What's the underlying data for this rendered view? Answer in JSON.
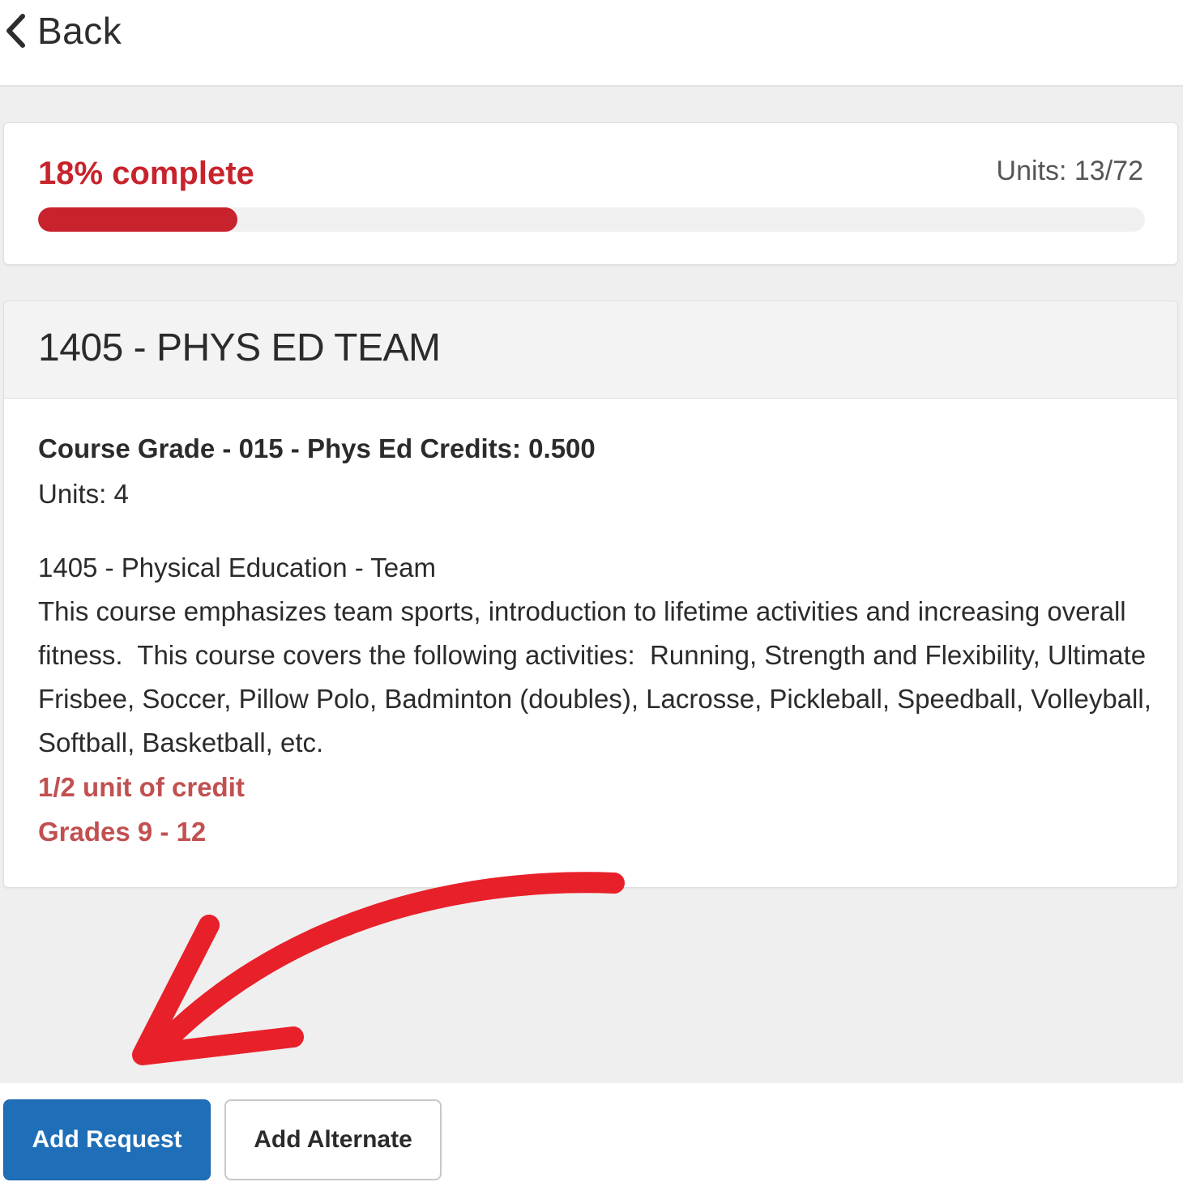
{
  "nav": {
    "back_label": "Back"
  },
  "progress": {
    "label": "18% complete",
    "percent": 18,
    "units_label": "Units: 13/72"
  },
  "course": {
    "title": "1405 - PHYS ED TEAM",
    "grade_line": "Course Grade - 015 - Phys Ed Credits: 0.500",
    "units_line": "Units: 4",
    "description_title": "1405 - Physical Education - Team",
    "description": "This course emphasizes team sports, introduction to lifetime activities and increasing overall fitness.  This course covers the following activities:  Running, Strength and Flexibility, Ultimate Frisbee, Soccer, Pillow Polo, Badminton (doubles), Lacrosse, Pickleball, Speedball, Volleyball, Softball, Basketball, etc.",
    "credit_note": "1/2 unit of credit",
    "grades_note": "Grades 9 - 12"
  },
  "actions": {
    "add_request_label": "Add Request",
    "add_alternate_label": "Add Alternate"
  },
  "colors": {
    "accent_red": "#c8232c",
    "note_red": "#c25050",
    "primary_blue": "#1e6fb8",
    "annotation_arrow": "#e8202a"
  },
  "icons": {
    "back": "chevron-left-icon",
    "annotation": "curved-arrow-icon"
  }
}
